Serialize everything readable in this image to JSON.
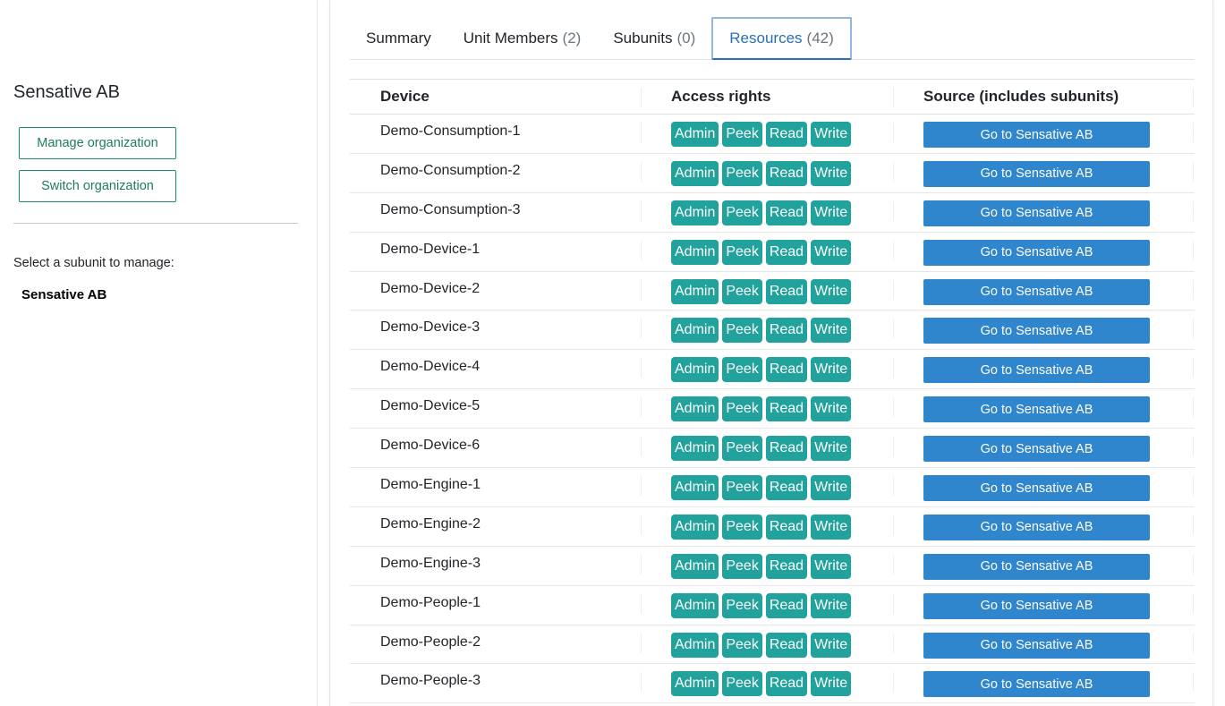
{
  "sidebar": {
    "org_name": "Sensative AB",
    "manage_label": "Manage organization",
    "switch_label": "Switch organization",
    "subunit_prompt": "Select a subunit to manage:",
    "subunits": [
      "Sensative AB"
    ]
  },
  "tabs": [
    {
      "label": "Summary",
      "count": ""
    },
    {
      "label": "Unit Members",
      "count": "(2)"
    },
    {
      "label": "Subunits",
      "count": "(0)"
    },
    {
      "label": "Resources",
      "count": "(42)"
    }
  ],
  "active_tab": "Resources",
  "table": {
    "headers": {
      "device": "Device",
      "rights": "Access rights",
      "source": "Source (includes subunits)"
    },
    "rights_labels": [
      "Admin",
      "Peek",
      "Read",
      "Write"
    ],
    "goto_label": "Go to Sensative AB",
    "rows": [
      "Demo-Consumption-1",
      "Demo-Consumption-2",
      "Demo-Consumption-3",
      "Demo-Device-1",
      "Demo-Device-2",
      "Demo-Device-3",
      "Demo-Device-4",
      "Demo-Device-5",
      "Demo-Device-6",
      "Demo-Engine-1",
      "Demo-Engine-2",
      "Demo-Engine-3",
      "Demo-People-1",
      "Demo-People-2",
      "Demo-People-3"
    ]
  },
  "colors": {
    "accent_green": "#1f8a6c",
    "badge_teal": "#21a29d",
    "button_blue": "#2f86cc",
    "tab_active_blue": "#2a6fb8"
  }
}
